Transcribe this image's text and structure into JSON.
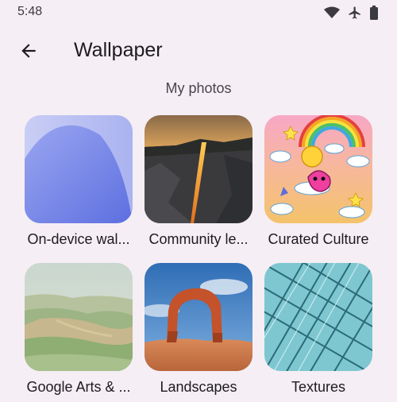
{
  "status": {
    "time": "5:48"
  },
  "header": {
    "title": "Wallpaper"
  },
  "section": {
    "label": "My photos"
  },
  "tiles": [
    {
      "label": "On-device wal..."
    },
    {
      "label": "Community le..."
    },
    {
      "label": "Curated Culture"
    },
    {
      "label": "Google Arts & ..."
    },
    {
      "label": "Landscapes"
    },
    {
      "label": "Textures"
    }
  ],
  "colors": {
    "background": "#f5eef4",
    "text": "#1d1b20"
  },
  "icons": [
    "wifi-icon",
    "airplane-icon",
    "battery-icon",
    "back-arrow-icon"
  ]
}
